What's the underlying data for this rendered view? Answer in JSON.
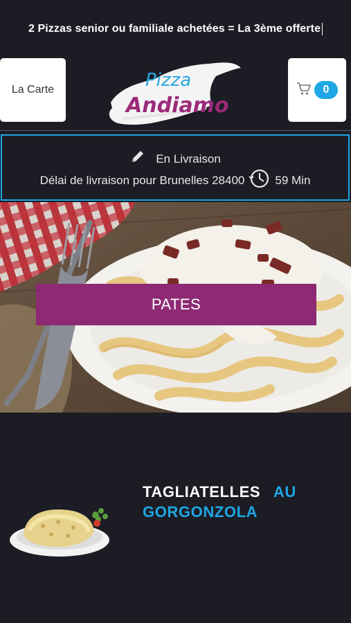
{
  "promo": {
    "text": "2 Pizzas senior ou familiale achetées = La 3ème offerte"
  },
  "header": {
    "menu_label": "La Carte",
    "cart_count": "0",
    "logo_line1": "Pizza",
    "logo_line2": "Andiamo"
  },
  "delivery": {
    "mode": "En Livraison",
    "delay_label": "Délai de livraison pour Brunelles 28400",
    "delay_time": "59 Min"
  },
  "hero": {
    "category_label": "PATES"
  },
  "product": {
    "name_part1": "TAGLIATELLES",
    "name_part2": "AU",
    "name_part3": "GORGONZOLA"
  },
  "colors": {
    "background": "#1b1c24",
    "accent_blue": "#1ea7e4",
    "category_purple": "#8e2a73"
  },
  "icons": [
    "cart-icon",
    "pencil-icon",
    "clock-icon"
  ]
}
